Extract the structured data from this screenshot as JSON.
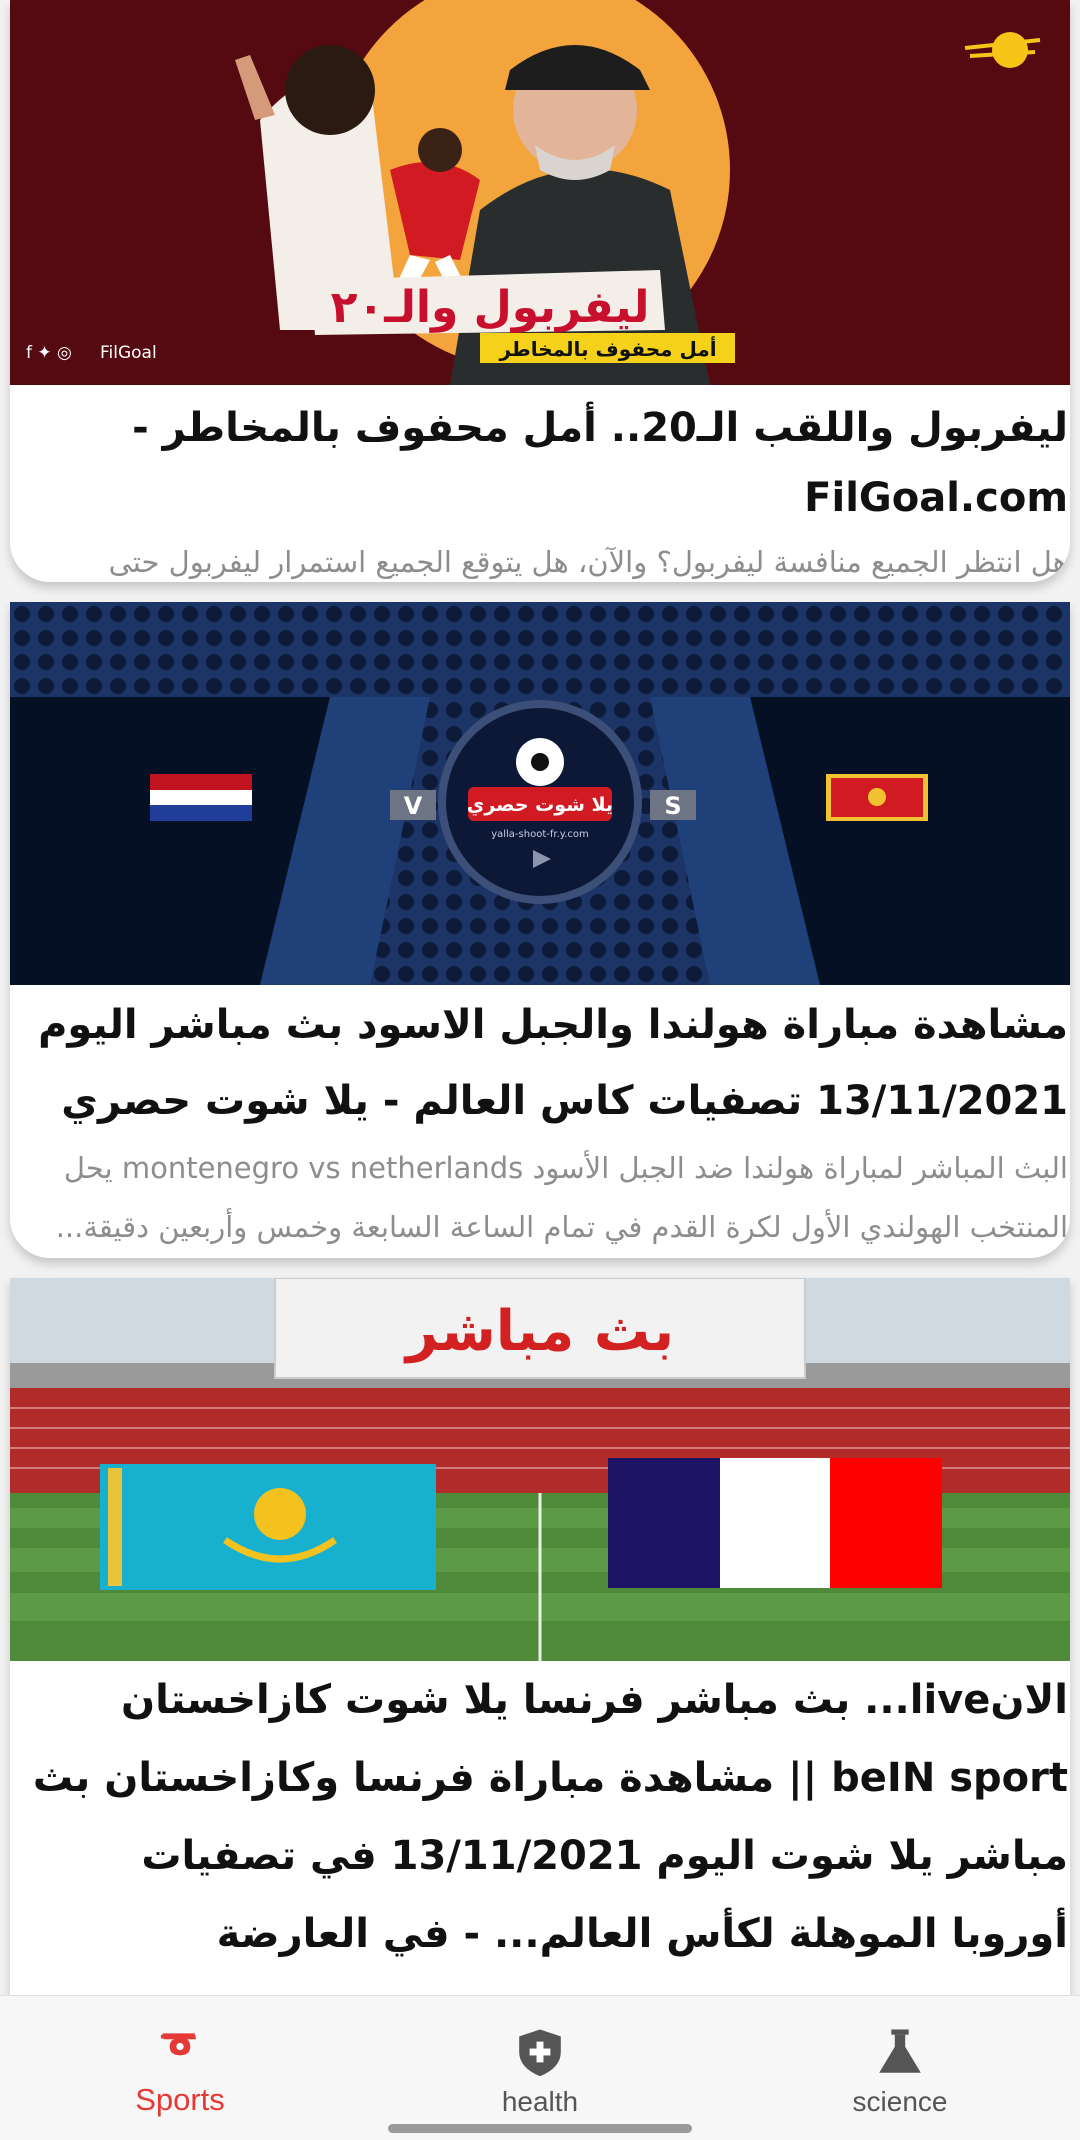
{
  "articles": [
    {
      "title": "ليفربول واللقب الـ20.. أمل محفوف بالمخاطر - FilGoal.com",
      "description": "هل انتظر الجميع منافسة ليفربول؟ والآن، هل يتوقع الجميع استمرار ليفربول حتى النهاية؟",
      "image": {
        "headline": "ليفربول والـ٢٠",
        "subline": "أمل محفوف بالمخاطر",
        "brand": "FilGoal",
        "colors": {
          "background": "#5a0a12",
          "circle": "#f3a43c",
          "ribbon": "#f5d11a"
        }
      }
    },
    {
      "title": "مشاهدة مباراة هولندا والجبل الاسود بث مباشر اليوم 13/11/2021 تصفيات كاس العالم - يلا شوت حصري",
      "description": "البث المباشر لمباراة هولندا ضد الجبل الأسود montenegro vs netherlands يحل المنتخب الهولندي الأول لكرة القدم في تمام الساعة السابعة وخمس وأربعين دقيقة...",
      "image": {
        "left_letter": "V",
        "right_letter": "S",
        "logo_text": "يلا شوت حصري",
        "logo_url_text": "yalla-shoot-fr.y.com",
        "colors": {
          "background": "#1c2f5c",
          "panel": "#050a18"
        }
      }
    },
    {
      "title": "الانlive... بث مباشر فرنسا يلا شوت كازاخستان beIN sport || مشاهدة مباراة فرنسا وكازاخستان بث مباشر يلا شوت اليوم 13/11/2021 في تصفيات أوروبا الموهلة لكأس العالم... - في العارضة",
      "description": "",
      "image": {
        "banner": "بث مباشر",
        "colors": {
          "pitch": "#4f8a3a",
          "banner": "#d32020"
        }
      }
    }
  ],
  "bottom_nav": {
    "items": [
      {
        "label": "Sports",
        "icon": "whistle-icon",
        "active": true
      },
      {
        "label": "health",
        "icon": "shield-plus-icon",
        "active": false
      },
      {
        "label": "science",
        "icon": "flask-icon",
        "active": false
      }
    ],
    "colors": {
      "active": "#e53935",
      "inactive": "#555555"
    }
  }
}
